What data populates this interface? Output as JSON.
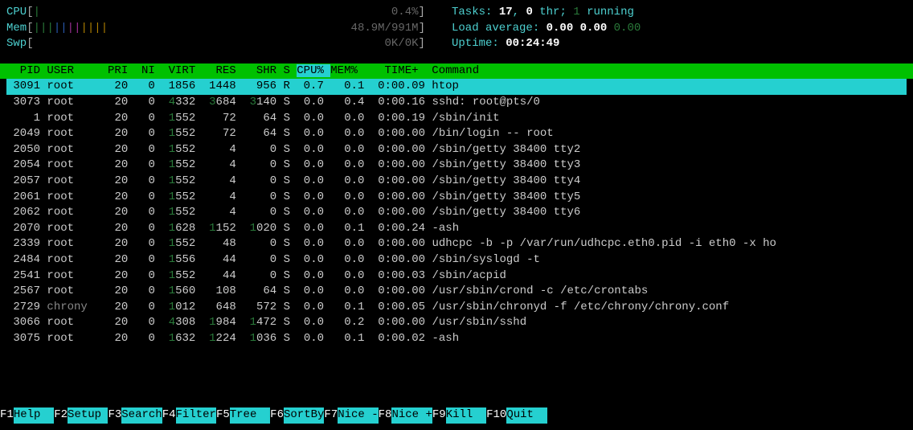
{
  "meters": {
    "cpu_label": "CPU",
    "cpu_bar": "|",
    "cpu_value": "0.4%",
    "mem_label": "Mem",
    "mem_bar": "|||||||||||",
    "mem_value": "48.9M/991M",
    "swp_label": "Swp",
    "swp_value": "0K/0K"
  },
  "stats": {
    "tasks_label": "Tasks: ",
    "tasks_total": "17",
    "tasks_thr": "0",
    "tasks_running": "1",
    "la_label": "Load average: ",
    "la1": "0.00",
    "la2": "0.00",
    "la3": "0.00",
    "uptime_label": "Uptime: ",
    "uptime_value": "00:24:49"
  },
  "columns": {
    "pid": "PID",
    "user": "USER",
    "pri": "PRI",
    "ni": "NI",
    "virt": "VIRT",
    "res": "RES",
    "shr": "SHR",
    "s": "S",
    "cpu": "CPU%",
    "mem": "MEM%",
    "time": "TIME+",
    "cmd": "Command"
  },
  "processes": [
    {
      "pid": "3091",
      "user": "root",
      "pri": "20",
      "ni": "0",
      "virt": "1856",
      "res": "1448",
      "shr": "956",
      "s": "R",
      "cpu": "0.7",
      "mem": "0.1",
      "time": "0:00.09",
      "cmd": "htop",
      "selected": true
    },
    {
      "pid": "3073",
      "user": "root",
      "pri": "20",
      "ni": "0",
      "virt": "4332",
      "res": "3684",
      "shr": "3140",
      "s": "S",
      "cpu": "0.0",
      "mem": "0.4",
      "time": "0:00.16",
      "cmd": "sshd: root@pts/0"
    },
    {
      "pid": "1",
      "user": "root",
      "pri": "20",
      "ni": "0",
      "virt": "1552",
      "res": "72",
      "shr": "64",
      "s": "S",
      "cpu": "0.0",
      "mem": "0.0",
      "time": "0:00.19",
      "cmd": "/sbin/init"
    },
    {
      "pid": "2049",
      "user": "root",
      "pri": "20",
      "ni": "0",
      "virt": "1552",
      "res": "72",
      "shr": "64",
      "s": "S",
      "cpu": "0.0",
      "mem": "0.0",
      "time": "0:00.00",
      "cmd": "/bin/login -- root"
    },
    {
      "pid": "2050",
      "user": "root",
      "pri": "20",
      "ni": "0",
      "virt": "1552",
      "res": "4",
      "shr": "0",
      "s": "S",
      "cpu": "0.0",
      "mem": "0.0",
      "time": "0:00.00",
      "cmd": "/sbin/getty 38400 tty2"
    },
    {
      "pid": "2054",
      "user": "root",
      "pri": "20",
      "ni": "0",
      "virt": "1552",
      "res": "4",
      "shr": "0",
      "s": "S",
      "cpu": "0.0",
      "mem": "0.0",
      "time": "0:00.00",
      "cmd": "/sbin/getty 38400 tty3"
    },
    {
      "pid": "2057",
      "user": "root",
      "pri": "20",
      "ni": "0",
      "virt": "1552",
      "res": "4",
      "shr": "0",
      "s": "S",
      "cpu": "0.0",
      "mem": "0.0",
      "time": "0:00.00",
      "cmd": "/sbin/getty 38400 tty4"
    },
    {
      "pid": "2061",
      "user": "root",
      "pri": "20",
      "ni": "0",
      "virt": "1552",
      "res": "4",
      "shr": "0",
      "s": "S",
      "cpu": "0.0",
      "mem": "0.0",
      "time": "0:00.00",
      "cmd": "/sbin/getty 38400 tty5"
    },
    {
      "pid": "2062",
      "user": "root",
      "pri": "20",
      "ni": "0",
      "virt": "1552",
      "res": "4",
      "shr": "0",
      "s": "S",
      "cpu": "0.0",
      "mem": "0.0",
      "time": "0:00.00",
      "cmd": "/sbin/getty 38400 tty6"
    },
    {
      "pid": "2070",
      "user": "root",
      "pri": "20",
      "ni": "0",
      "virt": "1628",
      "res": "1152",
      "shr": "1020",
      "s": "S",
      "cpu": "0.0",
      "mem": "0.1",
      "time": "0:00.24",
      "cmd": "-ash"
    },
    {
      "pid": "2339",
      "user": "root",
      "pri": "20",
      "ni": "0",
      "virt": "1552",
      "res": "48",
      "shr": "0",
      "s": "S",
      "cpu": "0.0",
      "mem": "0.0",
      "time": "0:00.00",
      "cmd": "udhcpc -b -p /var/run/udhcpc.eth0.pid -i eth0 -x ho"
    },
    {
      "pid": "2484",
      "user": "root",
      "pri": "20",
      "ni": "0",
      "virt": "1556",
      "res": "44",
      "shr": "0",
      "s": "S",
      "cpu": "0.0",
      "mem": "0.0",
      "time": "0:00.00",
      "cmd": "/sbin/syslogd -t"
    },
    {
      "pid": "2541",
      "user": "root",
      "pri": "20",
      "ni": "0",
      "virt": "1552",
      "res": "44",
      "shr": "0",
      "s": "S",
      "cpu": "0.0",
      "mem": "0.0",
      "time": "0:00.03",
      "cmd": "/sbin/acpid"
    },
    {
      "pid": "2567",
      "user": "root",
      "pri": "20",
      "ni": "0",
      "virt": "1560",
      "res": "108",
      "shr": "64",
      "s": "S",
      "cpu": "0.0",
      "mem": "0.0",
      "time": "0:00.00",
      "cmd": "/usr/sbin/crond -c /etc/crontabs"
    },
    {
      "pid": "2729",
      "user": "chrony",
      "pri": "20",
      "ni": "0",
      "virt": "1012",
      "res": "648",
      "shr": "572",
      "s": "S",
      "cpu": "0.0",
      "mem": "0.1",
      "time": "0:00.05",
      "cmd": "/usr/sbin/chronyd -f /etc/chrony/chrony.conf"
    },
    {
      "pid": "3066",
      "user": "root",
      "pri": "20",
      "ni": "0",
      "virt": "4308",
      "res": "1984",
      "shr": "1472",
      "s": "S",
      "cpu": "0.0",
      "mem": "0.2",
      "time": "0:00.00",
      "cmd": "/usr/sbin/sshd"
    },
    {
      "pid": "3075",
      "user": "root",
      "pri": "20",
      "ni": "0",
      "virt": "1632",
      "res": "1224",
      "shr": "1036",
      "s": "S",
      "cpu": "0.0",
      "mem": "0.1",
      "time": "0:00.02",
      "cmd": "-ash"
    }
  ],
  "footer": [
    {
      "key": "F1",
      "label": "Help  "
    },
    {
      "key": "F2",
      "label": "Setup "
    },
    {
      "key": "F3",
      "label": "Search"
    },
    {
      "key": "F4",
      "label": "Filter"
    },
    {
      "key": "F5",
      "label": "Tree  "
    },
    {
      "key": "F6",
      "label": "SortBy"
    },
    {
      "key": "F7",
      "label": "Nice -"
    },
    {
      "key": "F8",
      "label": "Nice +"
    },
    {
      "key": "F9",
      "label": "Kill  "
    },
    {
      "key": "F10",
      "label": "Quit  "
    }
  ]
}
